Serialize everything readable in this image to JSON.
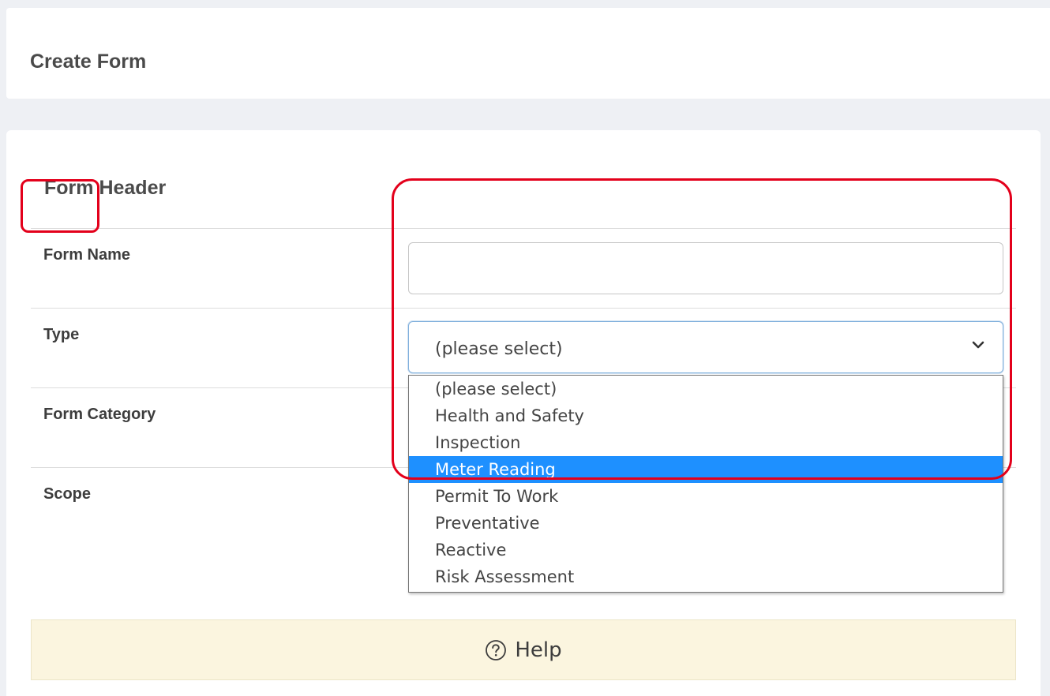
{
  "header": {
    "title": "Create Form"
  },
  "form_header": {
    "title": "Form Header",
    "fields": {
      "form_name": {
        "label": "Form Name",
        "value": ""
      },
      "type": {
        "label": "Type",
        "selected_value": "(please select)"
      },
      "form_category": {
        "label": "Form Category"
      },
      "scope": {
        "label": "Scope"
      }
    }
  },
  "type_dropdown": {
    "options": [
      {
        "label": "(please select)",
        "selected": false
      },
      {
        "label": "Health and Safety",
        "selected": false
      },
      {
        "label": "Inspection",
        "selected": false
      },
      {
        "label": "Meter Reading",
        "selected": true
      },
      {
        "label": "Permit To Work",
        "selected": false
      },
      {
        "label": "Preventative",
        "selected": false
      },
      {
        "label": "Reactive",
        "selected": false
      },
      {
        "label": "Risk Assessment",
        "selected": false
      }
    ]
  },
  "help": {
    "label": "Help",
    "icon": "question-circle-icon"
  },
  "colors": {
    "highlight_annotation": "#e3001b",
    "selected_option_bg": "#1e90ff",
    "help_bar_bg": "#fbf5df"
  }
}
